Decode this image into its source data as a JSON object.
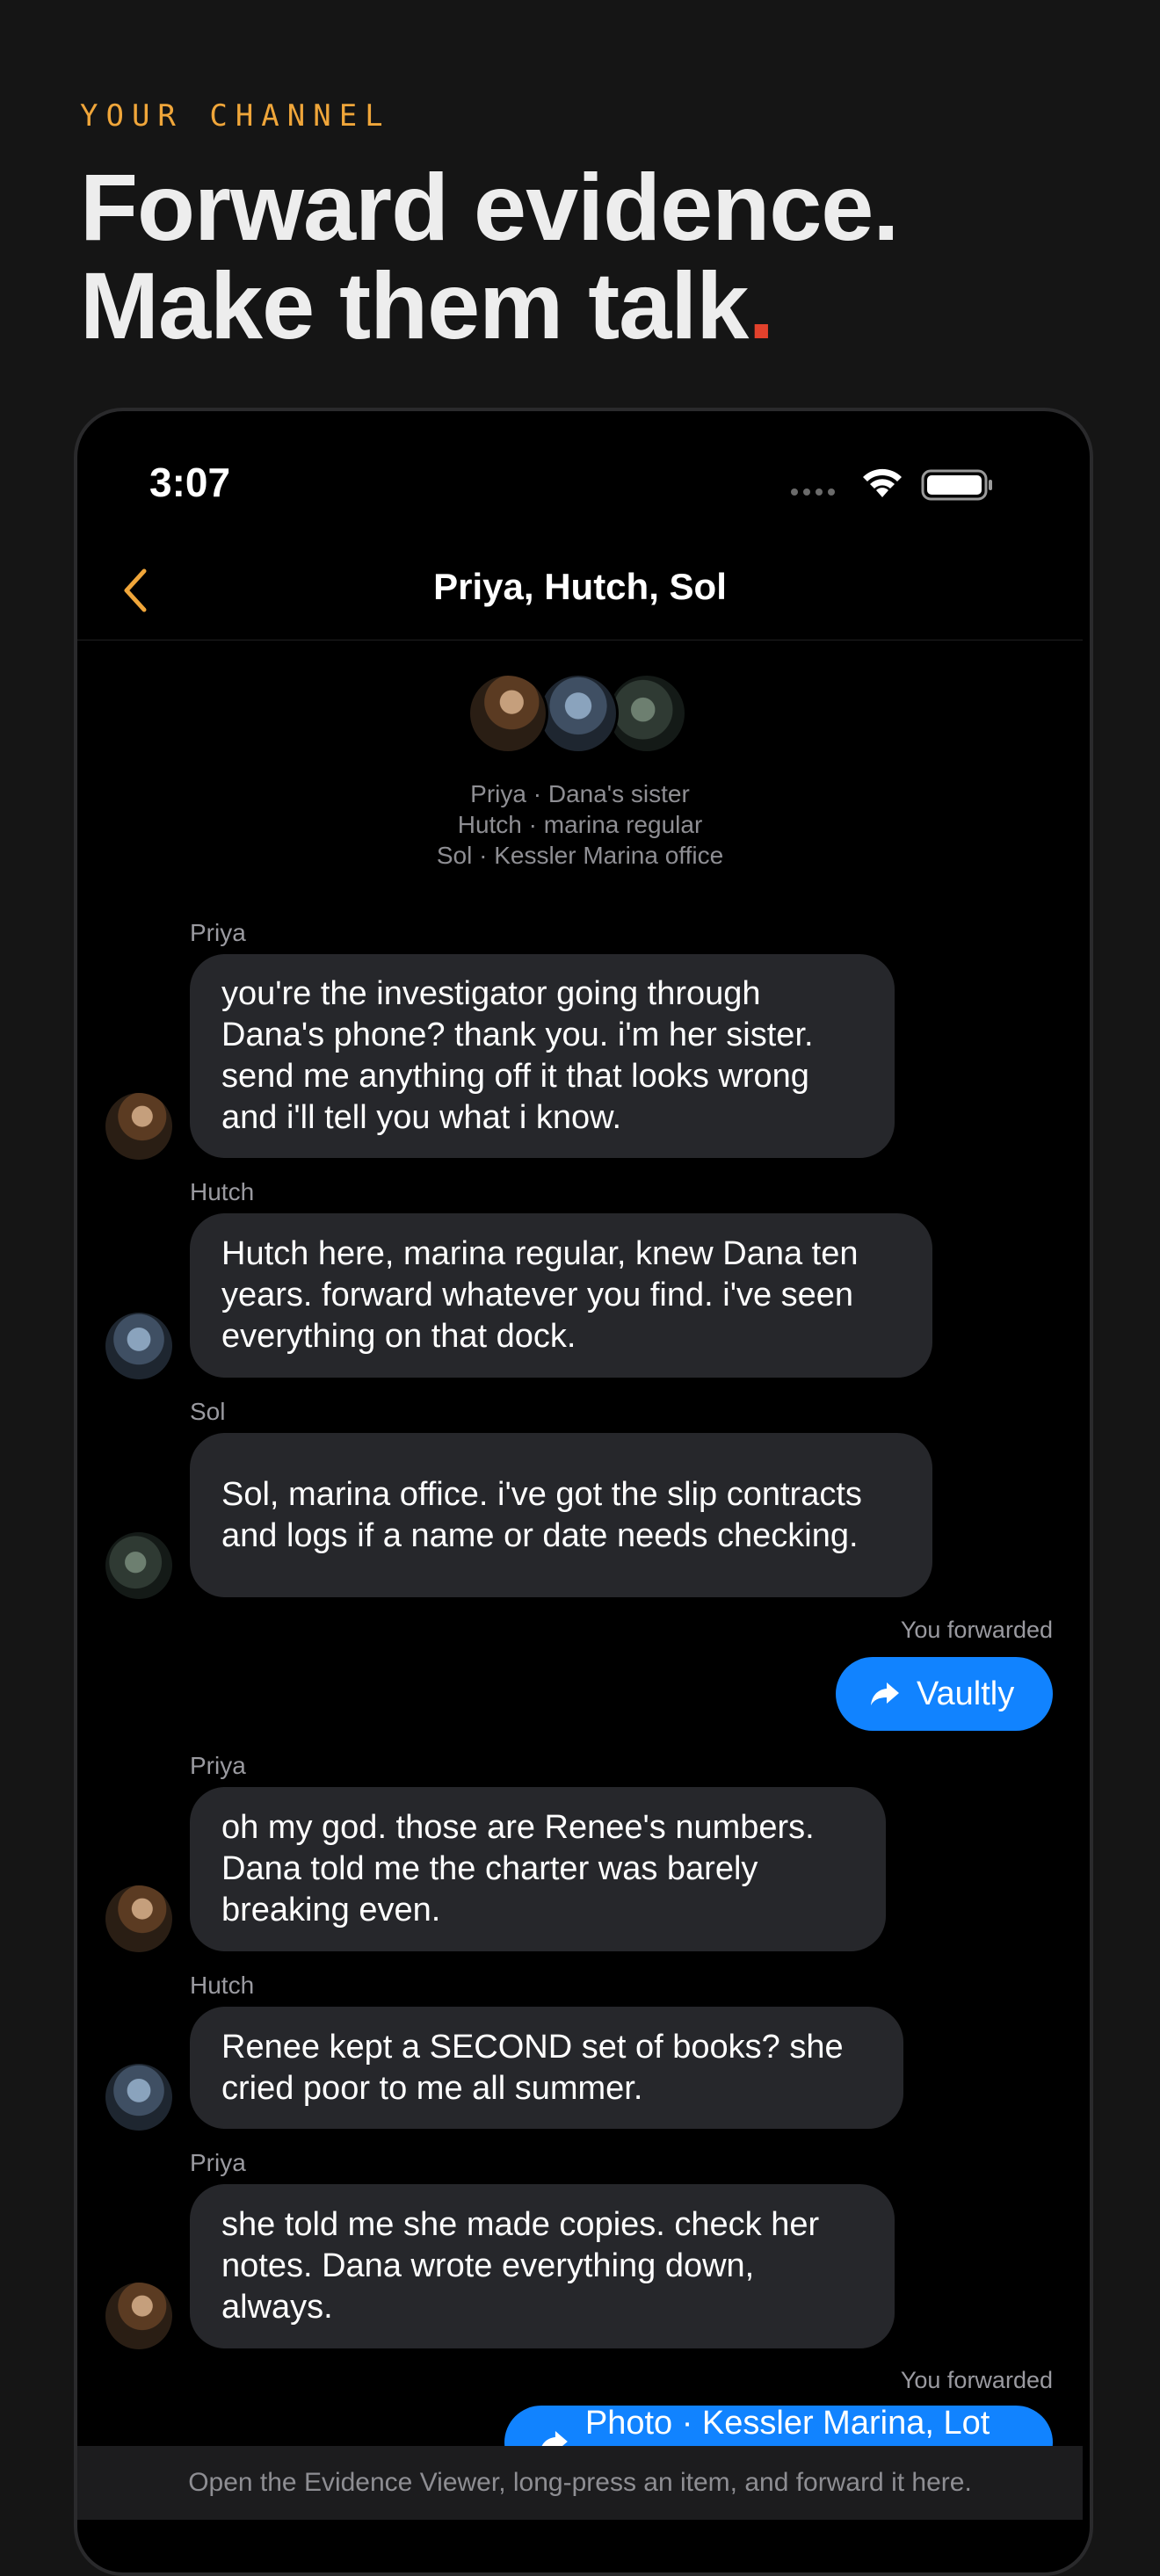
{
  "kicker": "YOUR CHANNEL",
  "headline": {
    "line1": "Forward evidence.",
    "line2_text": "Make them talk",
    "line2_dot": "."
  },
  "status_bar": {
    "time": "3:07"
  },
  "nav": {
    "title": "Priya, Hutch, Sol"
  },
  "participants": [
    "Priya · Dana's sister",
    "Hutch · marina regular",
    "Sol · Kessler Marina office"
  ],
  "messages": [
    {
      "sender": "Priya",
      "text": "you're the investigator going through Dana's phone? thank you. i'm her sister. send me anything off it that looks wrong and i'll tell you what i know."
    },
    {
      "sender": "Hutch",
      "text": "Hutch here, marina regular, knew Dana ten years. forward whatever you find. i've seen everything on that dock."
    },
    {
      "sender": "Sol",
      "text": "Sol, marina office. i've got the slip contracts and logs if a name or date needs checking."
    },
    {
      "forwarded_label": "You forwarded",
      "forwarded_item": "Vaultly"
    },
    {
      "sender": "Priya",
      "text": "oh my god. those are Renee's numbers. Dana told me the charter was barely breaking even."
    },
    {
      "sender": "Hutch",
      "text": "Renee kept a SECOND set of books? she cried poor to me all summer."
    },
    {
      "sender": "Priya",
      "text": "she told me she made copies. check her notes. Dana wrote everything down, always."
    },
    {
      "forwarded_label": "You forwarded",
      "forwarded_item": "Photo · Kessler Marina, Lot B"
    }
  ],
  "footer": "Open the Evidence Viewer, long-press an item, and forward it here.",
  "colors": {
    "accent": "#f0a63a",
    "headline_dot": "#e2412c",
    "forward_bubble": "#1183ff",
    "incoming_bubble": "#26272b"
  },
  "icons": [
    "back-chevron-icon",
    "wifi-icon",
    "battery-icon",
    "forward-arrow-icon"
  ]
}
